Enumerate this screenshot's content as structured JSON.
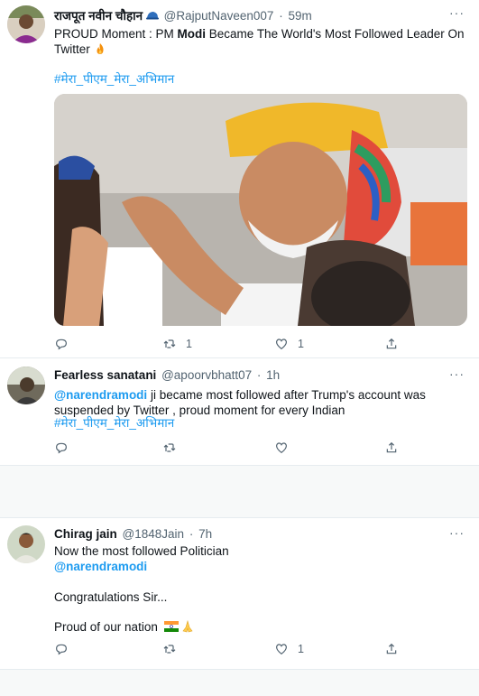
{
  "tweets": [
    {
      "name": "राजपूत नवीन चौहान",
      "handle": "@RajputNaveen007",
      "time": "59m",
      "text_prefix": "PROUD Moment : PM ",
      "text_bold": "Modi",
      "text_suffix": " Became The World's Most Followed Leader On Twitter",
      "hashtag": "#मेरा_पीएम_मेरा_अभिमान",
      "reply_count": "",
      "retweet_count": "1",
      "like_count": "1"
    },
    {
      "name": "Fearless sanatani",
      "handle": "@apoorvbhatt07",
      "time": "1h",
      "mention": "@narendramodi",
      "text": " ji became most followed after Trump's account was suspended by Twitter , proud moment for every Indian",
      "hashtag": "#मेरा_पीएम_मेरा_अभिमान",
      "reply_count": "",
      "retweet_count": "",
      "like_count": ""
    },
    {
      "name": "Chirag jain",
      "handle": "@1848Jain",
      "time": "7h",
      "line1": "Now the most followed Politician",
      "mention": "@narendramodi",
      "line3": "Congratulations Sir...",
      "line4": "Proud of our nation",
      "reply_count": "",
      "retweet_count": "",
      "like_count": "1"
    }
  ],
  "ui": {
    "dot": "·",
    "more": "···"
  },
  "colors": {
    "accent": "#1d9bf0",
    "muted": "#536471",
    "separator": "#f7f9f9"
  }
}
